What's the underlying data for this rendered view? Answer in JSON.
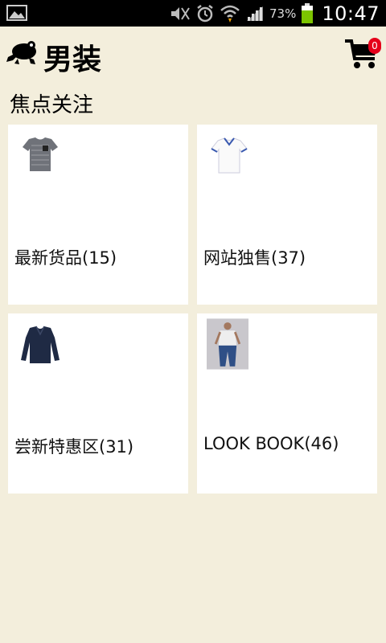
{
  "status_bar": {
    "battery_pct": "73%",
    "time": "10:47",
    "icons": [
      "gallery-icon",
      "mute-icon",
      "alarm-icon",
      "wifi-icon",
      "signal-icon",
      "battery-icon"
    ]
  },
  "header": {
    "title": "男装",
    "cart_count": "0",
    "icons": [
      "frog-logo-icon",
      "cart-icon"
    ]
  },
  "section": {
    "title": "焦点关注"
  },
  "cards": [
    {
      "label": "最新货品(15)",
      "icon": "gray-tshirt-icon"
    },
    {
      "label": "网站独售(37)",
      "icon": "white-polo-icon"
    },
    {
      "label": "尝新特惠区(31)",
      "icon": "navy-longsleeve-icon"
    },
    {
      "label": "LOOK BOOK(46)",
      "icon": "model-photo-icon"
    }
  ],
  "colors": {
    "background": "#f3eedc",
    "card": "#ffffff",
    "badge": "#e5001a",
    "battery": "#7cc400"
  }
}
